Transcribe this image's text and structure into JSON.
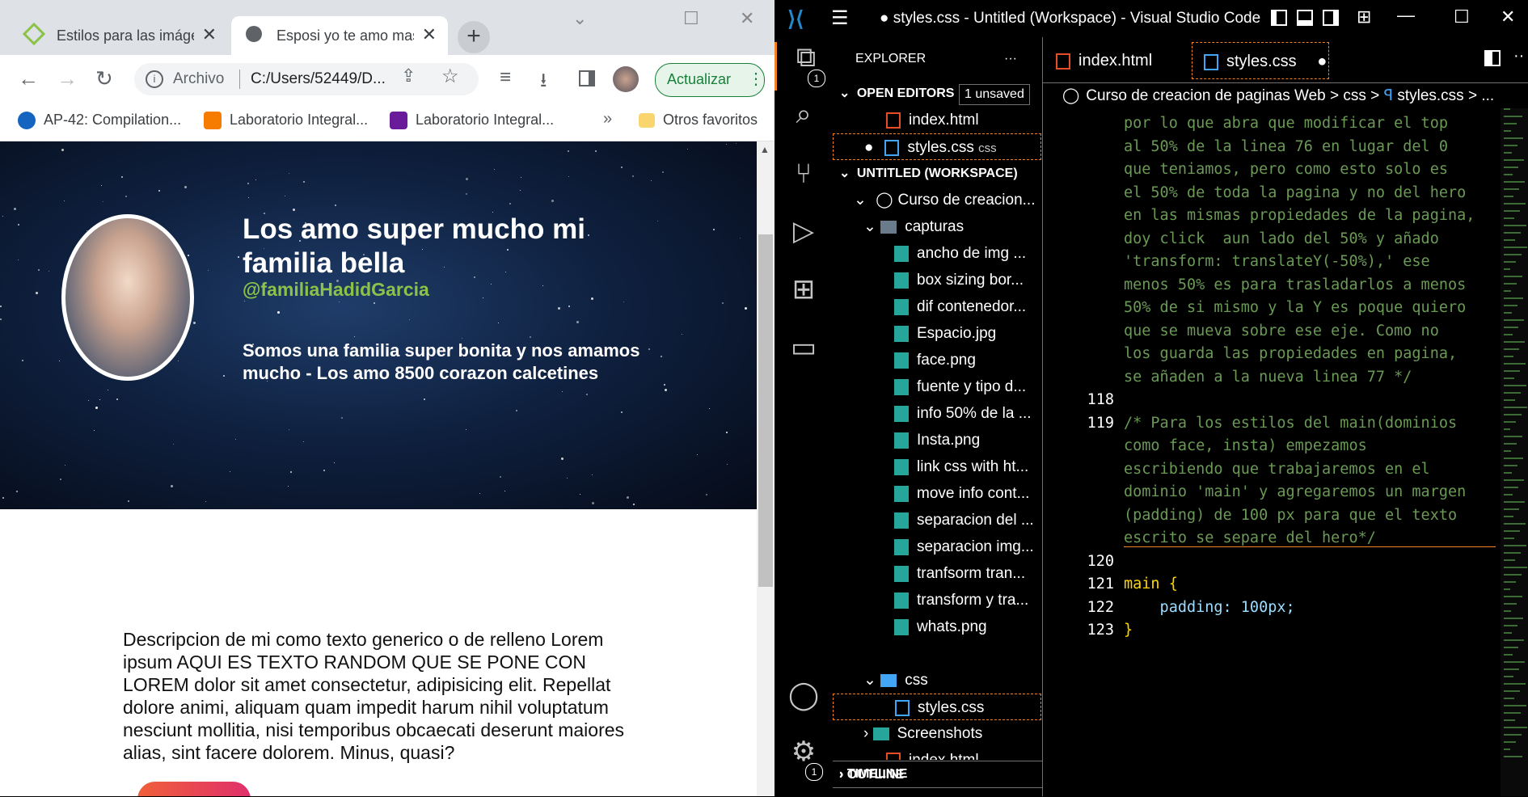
{
  "browser": {
    "tabs": [
      {
        "title": "Estilos para las imágenes",
        "active": false
      },
      {
        "title": "Esposi yo te amo mas",
        "active": true
      }
    ],
    "address": {
      "protocol_label": "Archivo",
      "url": "C:/Users/52449/D..."
    },
    "update_button": "Actualizar",
    "bookmarks": [
      {
        "label": "AP-42: Compilation...",
        "color": "#1565c0"
      },
      {
        "label": "Laboratorio Integral...",
        "color": "#f57c00"
      },
      {
        "label": "Laboratorio Integral...",
        "color": "#6a1b9a"
      }
    ],
    "bookmarks_overflow": "»",
    "other_bookmarks": "Otros favoritos"
  },
  "webpage": {
    "hero_title": "Los amo super mucho mi familia bella",
    "hero_handle": "@familiaHadidGarcia",
    "hero_description": "Somos una familia super bonita y nos amamos mucho - Los amo 8500 corazon calcetines",
    "main_paragraph": "Descripcion de mi como texto generico o de relleno Lorem ipsum AQUI ES TEXTO RANDOM QUE SE PONE CON LOREM dolor sit amet consectetur, adipisicing elit. Repellat dolore animi, aliquam quam impedit harum nihil voluptatum nesciunt mollitia, nisi temporibus obcaecati deserunt maiores alias, sint facere dolorem. Minus, quasi?"
  },
  "vscode": {
    "window_title": "● styles.css - Untitled (Workspace) - Visual Studio Code",
    "explorer_title": "EXPLORER",
    "explorer_more": "···",
    "open_editors": {
      "header": "OPEN EDITORS",
      "badge": "1 unsaved",
      "files": [
        "index.html",
        "styles.css"
      ],
      "active_hint": "css"
    },
    "workspace": {
      "header": "UNTITLED (WORKSPACE)",
      "root": "Curso de creacion...",
      "capturas_folder": "capturas",
      "capturas_files": [
        "ancho de img ...",
        "box sizing bor...",
        "dif contenedor...",
        "Espacio.jpg",
        "face.png",
        "fuente y tipo d...",
        "info 50% de la ...",
        "Insta.png",
        "link css with ht...",
        "move info cont...",
        "separacion del ...",
        "separacion img...",
        "tranfsorm tran...",
        "transform y tra...",
        "whats.png"
      ],
      "css_folder": "css",
      "css_files": [
        "styles.css"
      ],
      "screenshots_folder": "Screenshots",
      "index_file": "index.html"
    },
    "outline": "OUTLINE",
    "timeline": "TIMELINE",
    "editor_tabs": [
      {
        "label": "index.html",
        "active": false
      },
      {
        "label": "styles.css",
        "active": true
      }
    ],
    "breadcrumbs": [
      "Curso de creacion de paginas Web",
      ">",
      "css",
      ">",
      "styles.css",
      ">",
      "..."
    ],
    "code_lines": [
      {
        "num": "",
        "text": "por lo que abra que modificar el top",
        "cls": "cmt"
      },
      {
        "num": "",
        "text": "al 50% de la linea 76 en lugar del 0",
        "cls": "cmt"
      },
      {
        "num": "",
        "text": "que teniamos, pero como esto solo es",
        "cls": "cmt"
      },
      {
        "num": "",
        "text": "el 50% de toda la pagina y no del hero",
        "cls": "cmt"
      },
      {
        "num": "",
        "text": "en las mismas propiedades de la pagina,",
        "cls": "cmt"
      },
      {
        "num": "",
        "text": "doy click  aun lado del 50% y añado",
        "cls": "cmt"
      },
      {
        "num": "",
        "text": "'transform: translateY(-50%),' ese",
        "cls": "cmt"
      },
      {
        "num": "",
        "text": "menos 50% es para trasladarlos a menos",
        "cls": "cmt"
      },
      {
        "num": "",
        "text": "50% de si mismo y la Y es poque quiero",
        "cls": "cmt"
      },
      {
        "num": "",
        "text": "que se mueva sobre ese eje. Como no",
        "cls": "cmt"
      },
      {
        "num": "",
        "text": "los guarda las propiedades en pagina,",
        "cls": "cmt"
      },
      {
        "num": "",
        "text": "se añaden a la nueva linea 77 */",
        "cls": "cmt"
      },
      {
        "num": "118",
        "text": "",
        "cls": "cmt"
      },
      {
        "num": "119",
        "text": "/* Para los estilos del main(dominios",
        "cls": "cmt"
      },
      {
        "num": "",
        "text": "como face, insta) empezamos",
        "cls": "cmt"
      },
      {
        "num": "",
        "text": "escribiendo que trabajaremos en el",
        "cls": "cmt"
      },
      {
        "num": "",
        "text": "dominio 'main' y agregaremos un margen",
        "cls": "cmt"
      },
      {
        "num": "",
        "text": "(padding) de 100 px para que el texto",
        "cls": "cmt"
      },
      {
        "num": "",
        "text": "escrito se separe del hero*/",
        "cls": "cmt"
      },
      {
        "num": "120",
        "text": "",
        "cls": "cmt"
      },
      {
        "num": "121",
        "text": "main {",
        "cls": "kw"
      },
      {
        "num": "122",
        "text": "    padding: 100px;",
        "cls": "prop"
      },
      {
        "num": "123",
        "text": "}",
        "cls": "kw"
      }
    ]
  },
  "colors": {
    "accent_vscode": "#f48024",
    "comment": "#6a9955",
    "update_green": "#188038"
  }
}
